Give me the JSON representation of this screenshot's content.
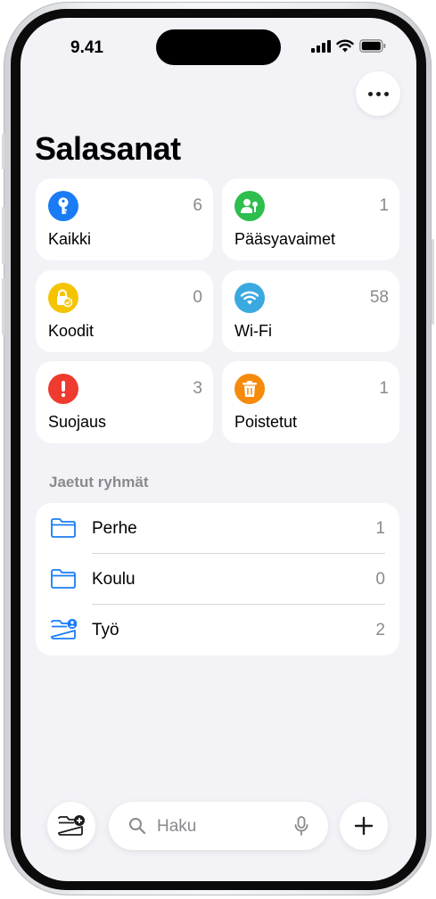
{
  "status_bar": {
    "time": "9.41"
  },
  "header": {
    "title": "Salasanat"
  },
  "categories": [
    {
      "label": "Kaikki",
      "count": "6",
      "icon": "key-icon",
      "color": "#1a7cf5"
    },
    {
      "label": "Pääsyavaimet",
      "count": "1",
      "icon": "passkey-icon",
      "color": "#2dbe4e"
    },
    {
      "label": "Koodit",
      "count": "0",
      "icon": "lock-check-icon",
      "color": "#f5c400"
    },
    {
      "label": "Wi-Fi",
      "count": "58",
      "icon": "wifi-icon",
      "color": "#3aa9e0"
    },
    {
      "label": "Suojaus",
      "count": "3",
      "icon": "exclamation-icon",
      "color": "#ee3a2f"
    },
    {
      "label": "Poistetut",
      "count": "1",
      "icon": "trash-icon",
      "color": "#f58a0b"
    }
  ],
  "shared_groups": {
    "header": "Jaetut ryhmät",
    "items": [
      {
        "name": "Perhe",
        "count": "1",
        "icon": "folder-icon"
      },
      {
        "name": "Koulu",
        "count": "0",
        "icon": "folder-icon"
      },
      {
        "name": "Työ",
        "count": "2",
        "icon": "shared-folder-icon"
      }
    ]
  },
  "toolbar": {
    "search_placeholder": "Haku"
  },
  "colors": {
    "accent": "#1a7cf5",
    "background": "#f2f2f7"
  }
}
